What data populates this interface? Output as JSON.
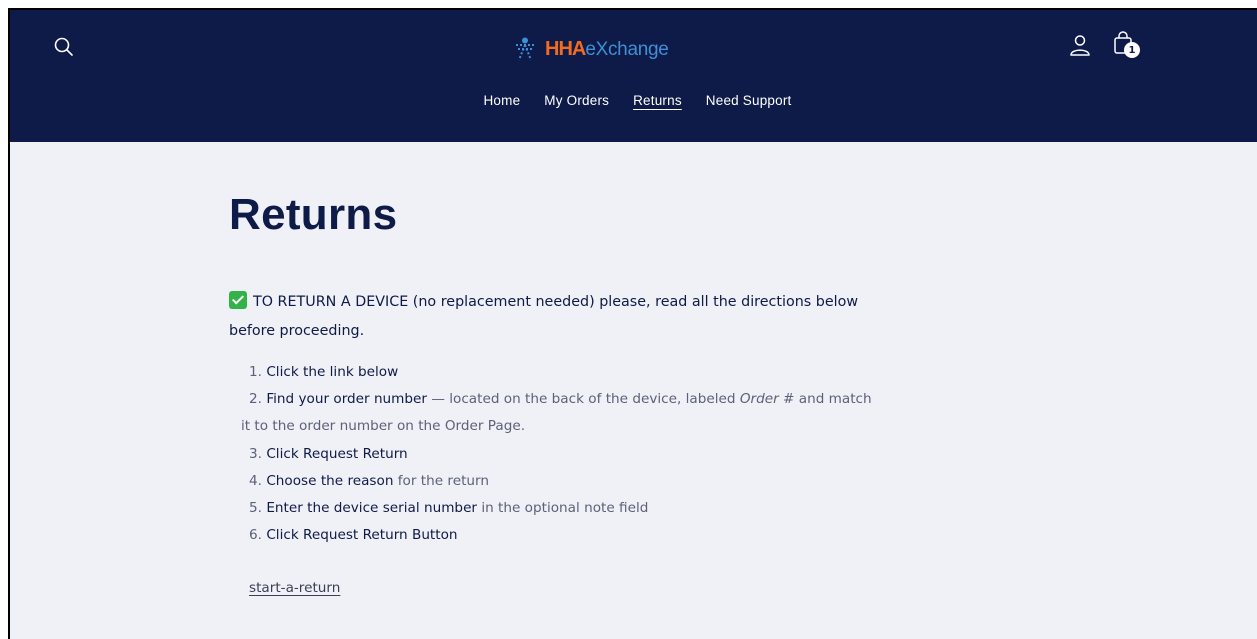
{
  "header": {
    "logo": {
      "brand": "HHA",
      "suffix": "eXchange"
    },
    "cart_count": "1",
    "nav": [
      {
        "label": "Home"
      },
      {
        "label": "My Orders"
      },
      {
        "label": "Returns",
        "active": true
      },
      {
        "label": "Need Support"
      }
    ]
  },
  "main": {
    "title": "Returns",
    "intro_line1": "TO RETURN A DEVICE (no replacement needed) please, read all the directions below",
    "intro_line2": "before proceeding.",
    "steps": [
      {
        "num": "1.",
        "strong": "Click the link below",
        "rest": ""
      },
      {
        "num": "2.",
        "strong": "Find your order number",
        "rest_a": " — located on the back of the device, labeled ",
        "italic": "Order #",
        "rest_b": " and match",
        "cont": "it to the order number on the Order Page."
      },
      {
        "num": "3.",
        "strong": "Click Request Return",
        "rest": ""
      },
      {
        "num": "4.",
        "strong": "Choose the reason",
        "rest": " for the return"
      },
      {
        "num": "5.",
        "strong": "Enter the device serial number",
        "rest": " in the optional note field"
      },
      {
        "num": "6.",
        "strong": "Click Request Return Button",
        "rest": ""
      }
    ],
    "link_label": "start-a-return"
  },
  "colors": {
    "header_bg": "#0e1a47",
    "page_bg": "#f0f1f6",
    "title": "#0e1a47",
    "logo_orange": "#f26b21",
    "logo_blue": "#3d8fd6",
    "check_green": "#34b24a"
  },
  "icons": [
    "search-icon",
    "logo-figure-icon",
    "account-icon",
    "cart-icon",
    "check-mark-icon"
  ]
}
